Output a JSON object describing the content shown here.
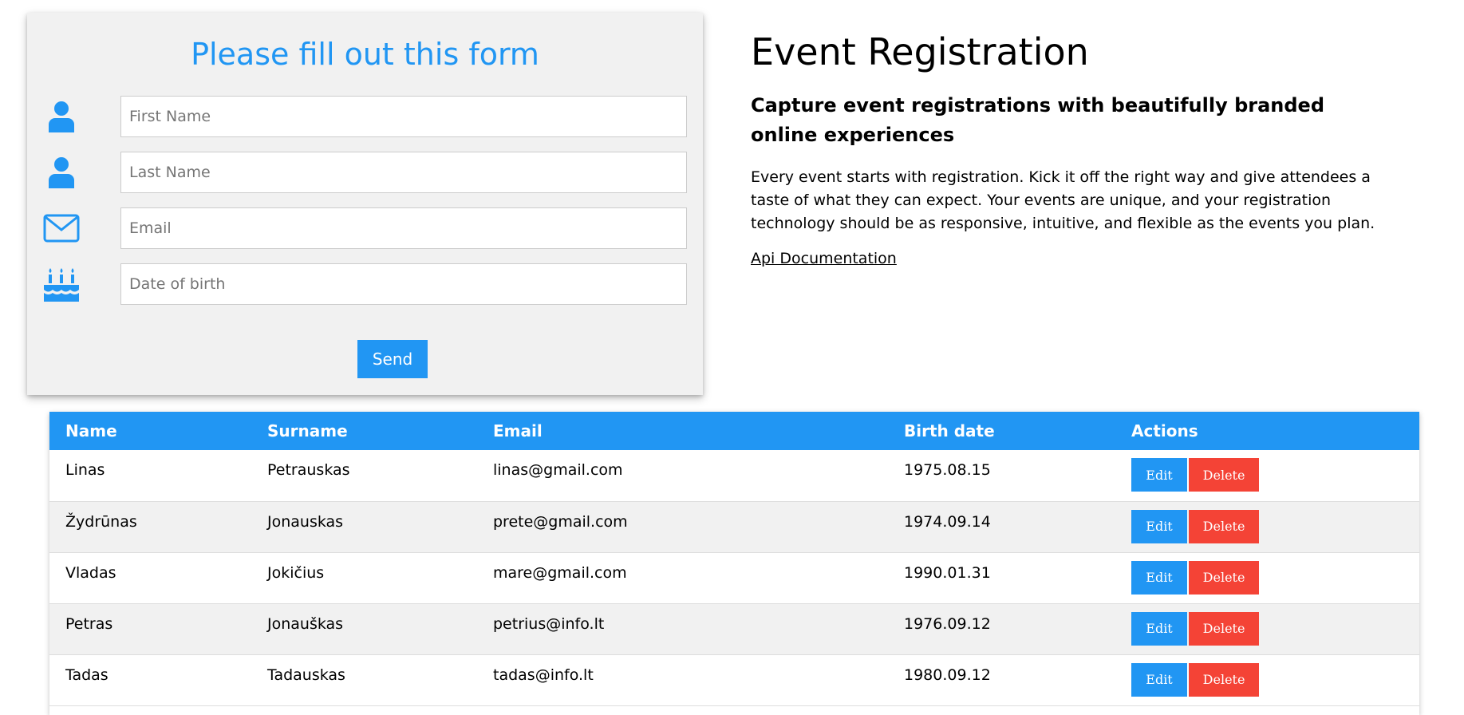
{
  "form": {
    "title": "Please fill out this form",
    "fields": [
      {
        "icon": "user-icon",
        "placeholder": "First Name"
      },
      {
        "icon": "user-icon",
        "placeholder": "Last Name"
      },
      {
        "icon": "envelope-icon",
        "placeholder": "Email"
      },
      {
        "icon": "birthday-cake-icon",
        "placeholder": "Date of birth"
      }
    ],
    "send_label": "Send"
  },
  "info": {
    "title": "Event Registration",
    "subtitle": "Capture event registrations with beautifully branded online experiences",
    "description": "Every event starts with registration. Kick it off the right way and give attendees a taste of what they can expect. Your events are unique, and your registration technology should be as responsive, intuitive, and flexible as the events you plan.",
    "link_label": "Api Documentation"
  },
  "table": {
    "headers": [
      "Name",
      "Surname",
      "Email",
      "Birth date",
      "Actions"
    ],
    "rows": [
      {
        "name": "Linas",
        "surname": "Petrauskas",
        "email": "linas@gmail.com",
        "birth": "1975.08.15"
      },
      {
        "name": "Žydrūnas",
        "surname": "Jonauskas",
        "email": "prete@gmail.com",
        "birth": "1974.09.14"
      },
      {
        "name": "Vladas",
        "surname": "Jokičius",
        "email": "mare@gmail.com",
        "birth": "1990.01.31"
      },
      {
        "name": "Petras",
        "surname": "Jonauškas",
        "email": "petrius@info.lt",
        "birth": "1976.09.12"
      },
      {
        "name": "Tadas",
        "surname": "Tadauskas",
        "email": "tadas@info.lt",
        "birth": "1980.09.12"
      }
    ],
    "edit_label": "Edit",
    "delete_label": "Delete"
  },
  "colors": {
    "accent": "#2196F3",
    "danger": "#f44336",
    "form_bg": "#f1f1f1"
  }
}
